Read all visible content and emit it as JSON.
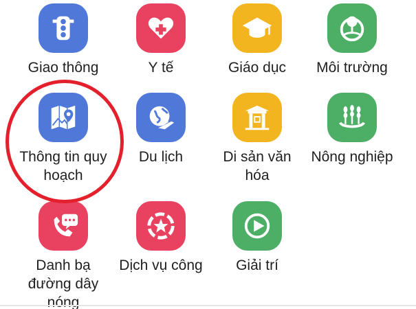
{
  "tiles": [
    {
      "label": "Giao thông",
      "icon": "traffic-light-icon",
      "color": "#4f78d8"
    },
    {
      "label": "Y tế",
      "icon": "heart-plus-icon",
      "color": "#e94260"
    },
    {
      "label": "Giáo dục",
      "icon": "graduation-cap-icon",
      "color": "#f3b51f"
    },
    {
      "label": "Môi trường",
      "icon": "globe-tree-icon",
      "color": "#4caf65"
    },
    {
      "label": "Thông tin quy hoạch",
      "icon": "map-pin-icon",
      "color": "#4f78d8"
    },
    {
      "label": "Du lịch",
      "icon": "globe-plane-icon",
      "color": "#4f78d8"
    },
    {
      "label": "Di sản văn hóa",
      "icon": "temple-gate-icon",
      "color": "#f3b51f"
    },
    {
      "label": "Nông nghiệp",
      "icon": "wheat-icon",
      "color": "#4caf65"
    },
    {
      "label": "Danh bạ đường dây nóng",
      "icon": "phone-chat-icon",
      "color": "#e94260"
    },
    {
      "label": "Dịch vụ công",
      "icon": "star-hands-icon",
      "color": "#e94260"
    },
    {
      "label": "Giải trí",
      "icon": "play-circle-icon",
      "color": "#4caf65"
    }
  ],
  "highlight": {
    "color": "#e3202b",
    "target": "Thông tin quy hoạch"
  }
}
